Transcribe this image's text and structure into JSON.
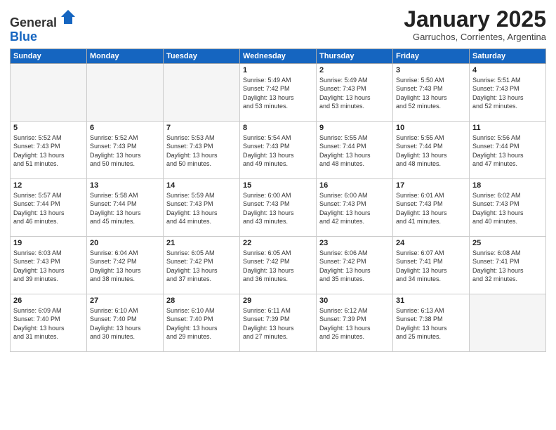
{
  "header": {
    "logo_general": "General",
    "logo_blue": "Blue",
    "month_title": "January 2025",
    "subtitle": "Garruchos, Corrientes, Argentina"
  },
  "weekdays": [
    "Sunday",
    "Monday",
    "Tuesday",
    "Wednesday",
    "Thursday",
    "Friday",
    "Saturday"
  ],
  "weeks": [
    [
      {
        "day": "",
        "info": ""
      },
      {
        "day": "",
        "info": ""
      },
      {
        "day": "",
        "info": ""
      },
      {
        "day": "1",
        "info": "Sunrise: 5:49 AM\nSunset: 7:42 PM\nDaylight: 13 hours\nand 53 minutes."
      },
      {
        "day": "2",
        "info": "Sunrise: 5:49 AM\nSunset: 7:43 PM\nDaylight: 13 hours\nand 53 minutes."
      },
      {
        "day": "3",
        "info": "Sunrise: 5:50 AM\nSunset: 7:43 PM\nDaylight: 13 hours\nand 52 minutes."
      },
      {
        "day": "4",
        "info": "Sunrise: 5:51 AM\nSunset: 7:43 PM\nDaylight: 13 hours\nand 52 minutes."
      }
    ],
    [
      {
        "day": "5",
        "info": "Sunrise: 5:52 AM\nSunset: 7:43 PM\nDaylight: 13 hours\nand 51 minutes."
      },
      {
        "day": "6",
        "info": "Sunrise: 5:52 AM\nSunset: 7:43 PM\nDaylight: 13 hours\nand 50 minutes."
      },
      {
        "day": "7",
        "info": "Sunrise: 5:53 AM\nSunset: 7:43 PM\nDaylight: 13 hours\nand 50 minutes."
      },
      {
        "day": "8",
        "info": "Sunrise: 5:54 AM\nSunset: 7:43 PM\nDaylight: 13 hours\nand 49 minutes."
      },
      {
        "day": "9",
        "info": "Sunrise: 5:55 AM\nSunset: 7:44 PM\nDaylight: 13 hours\nand 48 minutes."
      },
      {
        "day": "10",
        "info": "Sunrise: 5:55 AM\nSunset: 7:44 PM\nDaylight: 13 hours\nand 48 minutes."
      },
      {
        "day": "11",
        "info": "Sunrise: 5:56 AM\nSunset: 7:44 PM\nDaylight: 13 hours\nand 47 minutes."
      }
    ],
    [
      {
        "day": "12",
        "info": "Sunrise: 5:57 AM\nSunset: 7:44 PM\nDaylight: 13 hours\nand 46 minutes."
      },
      {
        "day": "13",
        "info": "Sunrise: 5:58 AM\nSunset: 7:44 PM\nDaylight: 13 hours\nand 45 minutes."
      },
      {
        "day": "14",
        "info": "Sunrise: 5:59 AM\nSunset: 7:43 PM\nDaylight: 13 hours\nand 44 minutes."
      },
      {
        "day": "15",
        "info": "Sunrise: 6:00 AM\nSunset: 7:43 PM\nDaylight: 13 hours\nand 43 minutes."
      },
      {
        "day": "16",
        "info": "Sunrise: 6:00 AM\nSunset: 7:43 PM\nDaylight: 13 hours\nand 42 minutes."
      },
      {
        "day": "17",
        "info": "Sunrise: 6:01 AM\nSunset: 7:43 PM\nDaylight: 13 hours\nand 41 minutes."
      },
      {
        "day": "18",
        "info": "Sunrise: 6:02 AM\nSunset: 7:43 PM\nDaylight: 13 hours\nand 40 minutes."
      }
    ],
    [
      {
        "day": "19",
        "info": "Sunrise: 6:03 AM\nSunset: 7:43 PM\nDaylight: 13 hours\nand 39 minutes."
      },
      {
        "day": "20",
        "info": "Sunrise: 6:04 AM\nSunset: 7:42 PM\nDaylight: 13 hours\nand 38 minutes."
      },
      {
        "day": "21",
        "info": "Sunrise: 6:05 AM\nSunset: 7:42 PM\nDaylight: 13 hours\nand 37 minutes."
      },
      {
        "day": "22",
        "info": "Sunrise: 6:05 AM\nSunset: 7:42 PM\nDaylight: 13 hours\nand 36 minutes."
      },
      {
        "day": "23",
        "info": "Sunrise: 6:06 AM\nSunset: 7:42 PM\nDaylight: 13 hours\nand 35 minutes."
      },
      {
        "day": "24",
        "info": "Sunrise: 6:07 AM\nSunset: 7:41 PM\nDaylight: 13 hours\nand 34 minutes."
      },
      {
        "day": "25",
        "info": "Sunrise: 6:08 AM\nSunset: 7:41 PM\nDaylight: 13 hours\nand 32 minutes."
      }
    ],
    [
      {
        "day": "26",
        "info": "Sunrise: 6:09 AM\nSunset: 7:40 PM\nDaylight: 13 hours\nand 31 minutes."
      },
      {
        "day": "27",
        "info": "Sunrise: 6:10 AM\nSunset: 7:40 PM\nDaylight: 13 hours\nand 30 minutes."
      },
      {
        "day": "28",
        "info": "Sunrise: 6:10 AM\nSunset: 7:40 PM\nDaylight: 13 hours\nand 29 minutes."
      },
      {
        "day": "29",
        "info": "Sunrise: 6:11 AM\nSunset: 7:39 PM\nDaylight: 13 hours\nand 27 minutes."
      },
      {
        "day": "30",
        "info": "Sunrise: 6:12 AM\nSunset: 7:39 PM\nDaylight: 13 hours\nand 26 minutes."
      },
      {
        "day": "31",
        "info": "Sunrise: 6:13 AM\nSunset: 7:38 PM\nDaylight: 13 hours\nand 25 minutes."
      },
      {
        "day": "",
        "info": ""
      }
    ]
  ]
}
